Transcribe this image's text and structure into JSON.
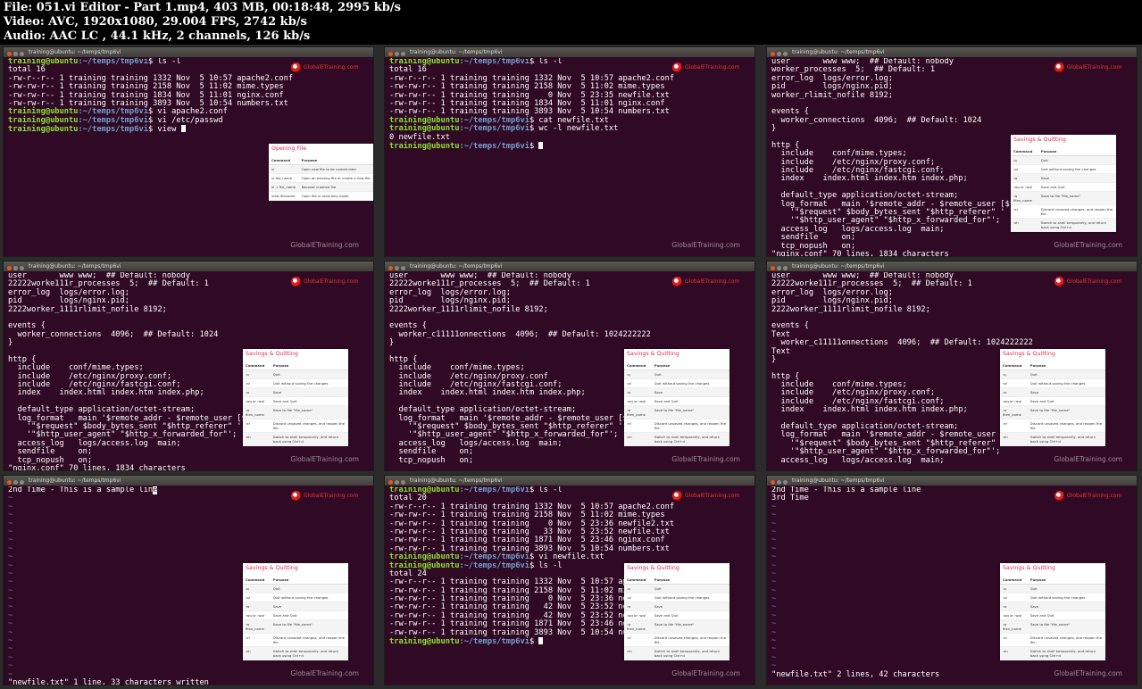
{
  "file_info": [
    "File: 051.vi Editor - Part 1.mp4, 403 MB, 00:18:48, 2995 kb/s",
    "Video: AVC, 1920x1080, 29.004 FPS, 2742 kb/s",
    "Audio: AAC LC , 44.1 kHz, 2 channels, 126 kb/s"
  ],
  "window_title": "training@ubuntu: ~/temps/tmp6vi",
  "watermark": "GlobalETraining.com",
  "logo_text": "GlobalETraining.com",
  "colors": {
    "terminal_bg": "#300a24",
    "prompt": "#8ae234",
    "path": "#729fcf",
    "panel_title": "#d9304a"
  },
  "opening_panel": {
    "title": "Opening File",
    "headers": [
      "Command",
      "Purpose"
    ],
    "rows": [
      [
        "vi",
        "Open new file to be named later"
      ],
      [
        "vi file_name",
        "Open an existing file or create a new file"
      ],
      [
        "vi -r file_name",
        "Recover crashed file"
      ],
      [
        "view filename",
        "Open file in read-only mode"
      ]
    ]
  },
  "saving_panel": {
    "title": "Savings & Quitting",
    "headers": [
      "Command",
      "Purpose"
    ],
    "rows": [
      [
        ":q",
        "Quit"
      ],
      [
        ":q!",
        "Quit without saving the changes"
      ],
      [
        ":w",
        "Save"
      ],
      [
        ":wq or :wq!",
        "Save and Quit"
      ],
      [
        ":w filen_name",
        "Save to file \"file_name\""
      ],
      [
        ":e!",
        "Discard unsaved changes, and reopen the file."
      ],
      [
        ":sh",
        "Switch to shell temporarily, and return back using Ctrl+d"
      ]
    ]
  },
  "tiles": [
    {
      "lines": [
        {
          "t": "p",
          "cmd": "ls -l"
        },
        "total 16",
        "-rw-r--r-- 1 training training 1332 Nov  5 10:57 apache2.conf",
        "-rw-rw-r-- 1 training training 2158 Nov  5 11:02 mime.types",
        "-rw-rw-r-- 1 training training 1834 Nov  5 11:01 nginx.conf",
        "-rw-rw-r-- 1 training training 3893 Nov  5 10:54 numbers.txt",
        {
          "t": "p",
          "cmd": "vi apache2.conf"
        },
        {
          "t": "p",
          "cmd": "vi /etc/passwd"
        },
        {
          "t": "p",
          "cmd": "view ",
          "cursor": true
        }
      ]
    },
    {
      "lines": [
        {
          "t": "p",
          "cmd": "ls -l"
        },
        "total 16",
        "-rw-r--r-- 1 training training 1332 Nov  5 10:57 apache2.conf",
        "-rw-rw-r-- 1 training training 2158 Nov  5 11:02 mime.types",
        "-rw-rw-r-- 1 training training    0 Nov  5 23:35 newfile.txt",
        "-rw-rw-r-- 1 training training 1834 Nov  5 11:01 nginx.conf",
        "-rw-rw-r-- 1 training training 3893 Nov  5 10:54 numbers.txt",
        {
          "t": "p",
          "cmd": "cat newfile.txt"
        },
        {
          "t": "p",
          "cmd": "wc -l newfile.txt"
        },
        "0 newfile.txt",
        {
          "t": "p",
          "cmd": "",
          "cursor": true
        }
      ]
    },
    {
      "lines": [
        "user       www www;  ## Default: nobody",
        "worker_processes  5;  ## Default: 1",
        "error_log  logs/error.log;",
        "pid        logs/nginx.pid;",
        "worker_rlimit_nofile 8192;",
        "",
        "events {",
        "  worker_connections  4096;  ## Default: 1024",
        "}",
        "",
        "http {",
        "  include    conf/mime.types;",
        "  include    /etc/nginx/proxy.conf;",
        "  include    /etc/nginx/fastcgi.conf;",
        "  index    index.html index.htm index.php;",
        "",
        "  default_type application/octet-stream;",
        "  log_format   main '$remote_addr - $remote_user [$ti",
        "    '\"$request\" $body_bytes_sent \"$http_referer\" '",
        "    '\"$http_user_agent\" \"$http_x_forwarded_for\"';",
        "  access_log   logs/access.log  main;",
        "  sendfile     on;",
        "  tcp_nopush   on;",
        "\"nginx.conf\" 70 lines, 1834 characters"
      ]
    },
    {
      "lines": [
        "user       www www;  ## Default: nobody",
        "22222worke111r_processes  5;  ## Default: 1",
        "error_log  logs/error.log;",
        "pid        logs/nginx.pid;",
        "2222worker_1111rlimit_nofile 8192;",
        "",
        "events {",
        "  worker_connections  4096;  ## Default: 1024",
        "}",
        "",
        "http {",
        "  include    conf/mime.types;",
        "  include    /etc/nginx/proxy.conf;",
        "  include    /etc/nginx/fastcgi.conf;",
        "  index    index.html index.htm index.php;",
        "",
        "  default_type application/octet-stream;",
        "  log_format   main '$remote_addr - $remote_user [$ti",
        "    '\"$request\" $body_bytes_sent \"$http_referer\" '",
        "    '\"$http_user_agent\" \"$http_x_forwarded_for\"';",
        "  access_log   logs/access.log  main;",
        "  sendfile     on;",
        "  tcp_nopush   on;",
        "\"nginx.conf\" 70 lines, 1834 characters"
      ]
    },
    {
      "lines": [
        "user       www www;  ## Default: nobody",
        "22222worke111r_processes  5;  ## Default: 1",
        "error_log  logs/error.log;",
        "pid        logs/nginx.pid;",
        "2222worker_1111rlimit_nofile 8192;",
        "",
        "events {",
        "  worker_c11111onnections  4096;  ## Default: 1024222222",
        "}",
        "",
        "http {",
        "  include    conf/mime.types;",
        "  include    /etc/nginx/proxy.conf",
        "  include    /etc/nginx/fastcgi.conf;",
        "  index    index.html index.htm index.php;",
        "",
        "  default_type application/octet-stream;",
        "  log_format   main '$remote_addr - $remote_user [$ti",
        "    '\"$request\" $body_bytes_sent \"$http_referer\" '",
        "    '\"$http_user_agent\" \"$http_x_forwarded_for\"';",
        "  access_log   logs/access.log  main;",
        "  sendfile     on;",
        "  tcp_nopush   on;"
      ]
    },
    {
      "lines": [
        "user       www www;  ## Default: nobody",
        "22222worke111r_processes  5;  ## Default: 1",
        "error_log  logs/error.log;",
        "pid        logs/nginx.pid;",
        "2222worker_1111rlimit_nofile 8192;",
        "",
        "events {",
        "Text",
        "  worker_c11111onnections  4096;  ## Default: 1024222222",
        "Text",
        "}",
        "",
        "http {",
        "  include    conf/mime.types;",
        "  include    /etc/nginx/proxy.conf;",
        "  include    /etc/nginx/fastcgi.conf;",
        "  index    index.html index.htm index.php;",
        "",
        "  default_type application/octet-stream;",
        "  log_format   main '$remote_addr - $remote_user [$ti",
        "    '\"$request\" $body_bytes_sent \"$http_referer\" '",
        "    '\"$http_user_agent\" \"$http_x_forwarded_for\"';",
        "  access_log   logs/access.log  main;"
      ]
    },
    {
      "lines": [
        {
          "t": "c",
          "text": "2nd Time - This is a sample lin",
          "cursor_char": "e"
        },
        "~",
        "~",
        "~",
        "~",
        "~",
        "~",
        "~",
        "~",
        "~",
        "~",
        "~",
        "~",
        "~",
        "~",
        "~",
        "~",
        "~",
        "~",
        "~",
        "~",
        "~",
        "~",
        "\"newfile.txt\" 1 line, 33 characters written"
      ]
    },
    {
      "lines": [
        {
          "t": "p",
          "cmd": "ls -l"
        },
        "total 20",
        "-rw-r--r-- 1 training training 1332 Nov  5 10:57 apache2.conf",
        "-rw-rw-r-- 1 training training 2158 Nov  5 11:02 mime.types",
        "-rw-rw-r-- 1 training training    0 Nov  5 23:36 newfile2.txt",
        "-rw-rw-r-- 1 training training   33 Nov  5 23:52 newfile.txt",
        "-rw-rw-r-- 1 training training 1871 Nov  5 23:46 nginx.conf",
        "-rw-rw-r-- 1 training training 3893 Nov  5 10:54 numbers.txt",
        {
          "t": "p",
          "cmd": "vi newfile.txt"
        },
        {
          "t": "p",
          "cmd": "ls -l"
        },
        "total 24",
        "-rw-r--r-- 1 training training 1332 Nov  5 10:57 apac",
        "-rw-rw-r-- 1 training training 2158 Nov  5 11:02 mime",
        "-rw-rw-r-- 1 training training    0 Nov  5 23:36 newf",
        "-rw-rw-r-- 1 training training   42 Nov  5 23:52 newf",
        "-rw-rw-r-- 1 training training   42 Nov  5 23:52 newf",
        "-rw-rw-r-- 1 training training 1871 Nov  5 23:46 ngin",
        "-rw-rw-r-- 1 training training 3893 Nov  5 10:54 numb",
        {
          "t": "p",
          "cmd": "",
          "cursor": true
        }
      ]
    },
    {
      "lines": [
        "2nd Time - This is a sample line",
        "3rd Time",
        "~",
        "~",
        "~",
        "~",
        "~",
        "~",
        "~",
        "~",
        "~",
        "~",
        "~",
        "~",
        "~",
        "~",
        "~",
        "~",
        "~",
        "~",
        "~",
        "~",
        "\"newfile.txt\" 2 lines, 42 characters"
      ]
    }
  ]
}
